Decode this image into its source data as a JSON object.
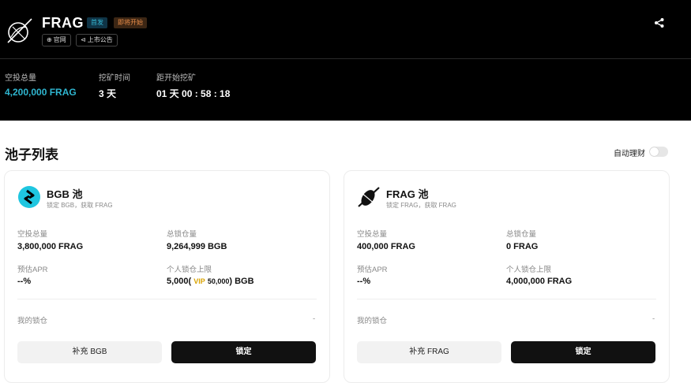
{
  "header": {
    "token": "FRAG",
    "badges": [
      "首发",
      "即将开始"
    ],
    "links": [
      {
        "icon": "globe-icon",
        "glyph": "⊕",
        "label": "官网"
      },
      {
        "icon": "megaphone-icon",
        "glyph": "⊲",
        "label": "上市公告"
      }
    ],
    "stats": [
      {
        "label": "空投总量",
        "value": "4,200,000 FRAG"
      },
      {
        "label": "挖矿时间",
        "value": "3 天"
      },
      {
        "label": "距开始挖矿",
        "value": "01 天 00 : 58 : 18"
      }
    ],
    "colors": {
      "accent": "#2fb6d0",
      "badge_first": "#35b8d4",
      "badge_soon": "#ec8f4a"
    }
  },
  "pools_section": {
    "title": "池子列表",
    "auto_label": "自动理财",
    "auto_on": false
  },
  "pools": [
    {
      "name": "BGB 池",
      "desc": "锁定 BGB，获取 FRAG",
      "airdrop_label": "空投总量",
      "airdrop_value": "3,800,000 FRAG",
      "total_label": "总锁仓量",
      "total_value": "9,264,999 BGB",
      "apr_label": "预估APR",
      "apr_value": "--%",
      "limit_label": "个人锁仓上限",
      "limit_main": "5,000",
      "limit_open": "(",
      "limit_vip": "VIP",
      "limit_vip_value": "50,000",
      "limit_close": ")",
      "limit_unit": "BGB",
      "mylock_label": "我的锁仓",
      "mylock_value": "-",
      "add_button": "补充 BGB",
      "lock_button": "锁定"
    },
    {
      "name": "FRAG 池",
      "desc": "锁定 FRAG，获取 FRAG",
      "airdrop_label": "空投总量",
      "airdrop_value": "400,000 FRAG",
      "total_label": "总锁仓量",
      "total_value": "0 FRAG",
      "apr_label": "预估APR",
      "apr_value": "--%",
      "limit_label": "个人锁仓上限",
      "limit_value": "4,000,000 FRAG",
      "mylock_label": "我的锁仓",
      "mylock_value": "-",
      "add_button": "补充 FRAG",
      "lock_button": "锁定"
    }
  ]
}
